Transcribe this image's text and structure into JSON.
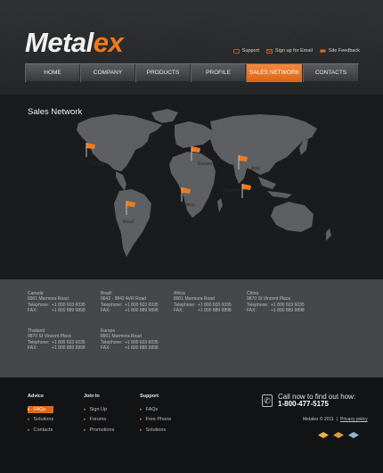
{
  "brand": {
    "logo_part1": "Metal",
    "logo_part2": "ex",
    "accent": "#f07a1e"
  },
  "top_links": [
    {
      "label": "Support",
      "icon": "headset-icon"
    },
    {
      "label": "Sign up for Email",
      "icon": "envelope-icon"
    },
    {
      "label": "Site Feedback",
      "icon": "chat-icon"
    }
  ],
  "nav": [
    {
      "label": "Home",
      "active": false
    },
    {
      "label": "Company",
      "active": false
    },
    {
      "label": "Products",
      "active": false
    },
    {
      "label": "Profile",
      "active": false
    },
    {
      "label": "Sales Network",
      "active": true
    },
    {
      "label": "Contacts",
      "active": false
    }
  ],
  "map": {
    "title": "Sales Network",
    "markers": [
      {
        "label": "Canada"
      },
      {
        "label": "Europe"
      },
      {
        "label": "Asia"
      },
      {
        "label": "Thailand"
      },
      {
        "label": "Africa"
      },
      {
        "label": "Brazil"
      }
    ]
  },
  "offices": [
    {
      "name": "Canada",
      "address": "8901 Marmora Road",
      "telephone": "+1 800 603 6035",
      "fax": "+1 800 889 9898"
    },
    {
      "name": "Brazil",
      "address": "9642 - 9842 AVR Road",
      "telephone": "+1 800 603 6035",
      "fax": "+1 800 889 9898"
    },
    {
      "name": "Africa",
      "address": "8901 Marmora Road",
      "telephone": "+1 800 603 6035",
      "fax": "+1 800 889 9898"
    },
    {
      "name": "China",
      "address": "9870 St Vincent Place",
      "telephone": "+1 800 603 6035",
      "fax": "+1 800 889 9898"
    },
    {
      "name": "Thailand",
      "address": "9870 St Vincent Place",
      "telephone": "+1 800 603 6035",
      "fax": "+1 800 889 9898"
    },
    {
      "name": "Europe",
      "address": "8901 Marmora Road",
      "telephone": "+1 800 603 6035",
      "fax": "+1 800 889 9898"
    }
  ],
  "office_labels": {
    "telephone": "Telephone:",
    "fax": "FAX:"
  },
  "footer": {
    "columns": [
      {
        "title": "Advice",
        "links": [
          {
            "label": "FAQs",
            "active": true
          },
          {
            "label": "Solutions",
            "active": false
          },
          {
            "label": "Contacts",
            "active": false
          }
        ]
      },
      {
        "title": "Join In",
        "links": [
          {
            "label": "Sign Up",
            "active": false
          },
          {
            "label": "Forums",
            "active": false
          },
          {
            "label": "Promotions",
            "active": false
          }
        ]
      },
      {
        "title": "Support",
        "links": [
          {
            "label": "FAQs",
            "active": false
          },
          {
            "label": "Free Phone",
            "active": false
          },
          {
            "label": "Solutions",
            "active": false
          }
        ]
      }
    ],
    "call_label": "Call now to find out how:",
    "phone": "1-800-477-5175",
    "copyright": "Metalex © 2011",
    "separator": "|",
    "privacy": "Privacy policy",
    "social_icons": [
      "social-icon-1",
      "social-icon-2",
      "social-icon-3"
    ]
  }
}
